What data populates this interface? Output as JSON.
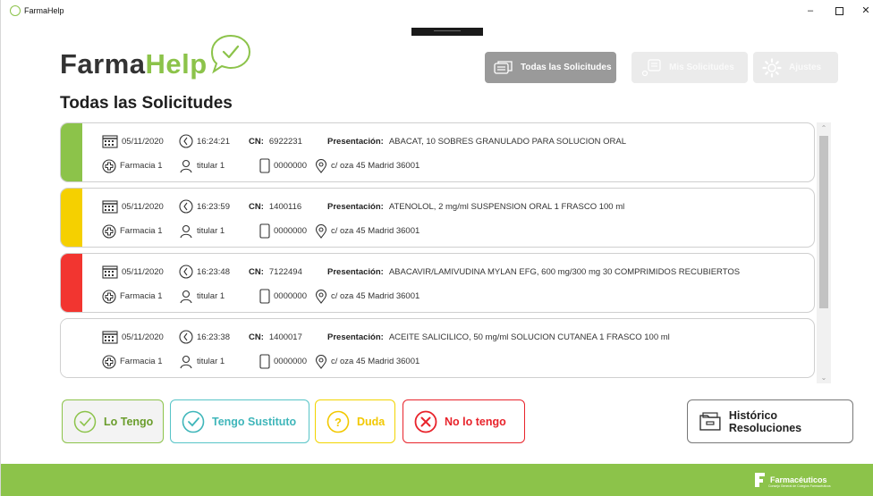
{
  "window": {
    "title": "FarmaHelp",
    "minimize": "–",
    "close": "✕"
  },
  "logo": {
    "part1": "Farma",
    "part2": "Help",
    "bubble_icon": "speech-bubble-check-icon"
  },
  "header": {
    "tabs": [
      {
        "label": "Todas las Solicitudes",
        "icon": "messages-icon",
        "active": true
      },
      {
        "label": "Mis Solicitudes",
        "icon": "my-requests-icon",
        "active": false
      },
      {
        "label": "Ajustes",
        "icon": "gear-icon",
        "active": false
      }
    ]
  },
  "page_title": "Todas las Solicitudes",
  "labels": {
    "cn": "CN:",
    "presentacion": "Presentación:"
  },
  "requests": [
    {
      "status_color": "#8cc34a",
      "date": "05/11/2020",
      "time": "16:24:21",
      "cn": "6922231",
      "presentacion": "ABACAT, 10 SOBRES GRANULADO PARA SOLUCION ORAL",
      "farmacia": "Farmacia 1",
      "titular": "titular 1",
      "phone": "0000000",
      "address": "c/ oza 45 Madrid 36001"
    },
    {
      "status_color": "#f5d000",
      "date": "05/11/2020",
      "time": "16:23:59",
      "cn": "1400116",
      "presentacion": "ATENOLOL, 2 mg/ml SUSPENSION ORAL 1 FRASCO 100 ml",
      "farmacia": "Farmacia 1",
      "titular": "titular 1",
      "phone": "0000000",
      "address": "c/ oza 45 Madrid 36001"
    },
    {
      "status_color": "#f23530",
      "date": "05/11/2020",
      "time": "16:23:48",
      "cn": "7122494",
      "presentacion": "ABACAVIR/LAMIVUDINA MYLAN EFG, 600 mg/300 mg 30 COMPRIMIDOS RECUBIERTOS",
      "farmacia": "Farmacia 1",
      "titular": "titular 1",
      "phone": "0000000",
      "address": "c/ oza 45 Madrid 36001"
    },
    {
      "status_color": "#ffffff",
      "date": "05/11/2020",
      "time": "16:23:38",
      "cn": "1400017",
      "presentacion": "ACEITE SALICILICO, 50 mg/ml SOLUCION CUTANEA 1 FRASCO 100 ml",
      "farmacia": "Farmacia 1",
      "titular": "titular 1",
      "phone": "0000000",
      "address": "c/ oza 45 Madrid 36001"
    }
  ],
  "actions": {
    "lo_tengo": "Lo Tengo",
    "tengo_sustituto": "Tengo Sustituto",
    "duda": "Duda",
    "no_lo_tengo": "No lo tengo",
    "historico": "Histórico Resoluciones"
  },
  "footer": {
    "brand_name": "Farmacéuticos",
    "brand_sub": "Consejo General de Colegios Farmacéuticos"
  },
  "colors": {
    "brand_green": "#8cc34a",
    "teal": "#57c4c7",
    "yellow": "#f2d400",
    "red": "#e8232b"
  }
}
